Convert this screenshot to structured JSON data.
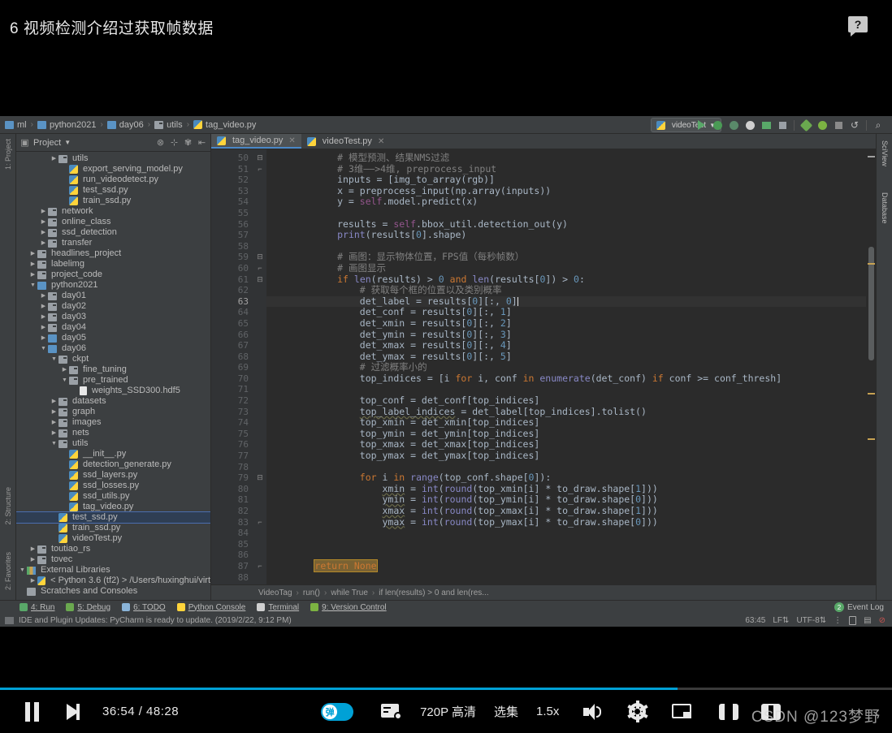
{
  "page": {
    "title": "6 视频检测介绍过获取帧数据",
    "help_icon": "help-bubble-icon",
    "help_glyph": "?"
  },
  "ide": {
    "breadcrumb": [
      {
        "label": "ml",
        "icon": "folder-icon"
      },
      {
        "label": "python2021",
        "icon": "folder-icon"
      },
      {
        "label": "day06",
        "icon": "folder-icon"
      },
      {
        "label": "utils",
        "icon": "folder-icon"
      },
      {
        "label": "tag_video.py",
        "icon": "python-file-icon"
      }
    ],
    "run_config": "videoTest",
    "toolbar_icons": [
      "run-icon",
      "debug-icon",
      "coverage-icon",
      "profile-icon",
      "attach-icon",
      "stop-icon",
      "update-icon",
      "vcs-icon",
      "window-icon",
      "undo-icon",
      "search-icon"
    ],
    "project_panel": {
      "title": "Project",
      "header_icons": [
        "collapse-icon",
        "expand-icon",
        "settings-icon",
        "hide-icon"
      ],
      "tree": [
        {
          "depth": 3,
          "arrow": "right",
          "icon": "folder",
          "label": "utils"
        },
        {
          "depth": 4,
          "arrow": "",
          "icon": "py",
          "label": "export_serving_model.py"
        },
        {
          "depth": 4,
          "arrow": "",
          "icon": "py",
          "label": "run_videodetect.py"
        },
        {
          "depth": 4,
          "arrow": "",
          "icon": "py",
          "label": "test_ssd.py"
        },
        {
          "depth": 4,
          "arrow": "",
          "icon": "py",
          "label": "train_ssd.py"
        },
        {
          "depth": 2,
          "arrow": "right",
          "icon": "folder",
          "label": "network"
        },
        {
          "depth": 2,
          "arrow": "right",
          "icon": "folder",
          "label": "online_class"
        },
        {
          "depth": 2,
          "arrow": "right",
          "icon": "folder",
          "label": "ssd_detection"
        },
        {
          "depth": 2,
          "arrow": "right",
          "icon": "folder",
          "label": "transfer"
        },
        {
          "depth": 1,
          "arrow": "right",
          "icon": "folder",
          "label": "headlines_project"
        },
        {
          "depth": 1,
          "arrow": "right",
          "icon": "folder",
          "label": "labelimg"
        },
        {
          "depth": 1,
          "arrow": "right",
          "icon": "folder",
          "label": "project_code"
        },
        {
          "depth": 1,
          "arrow": "down",
          "icon": "folder-open",
          "label": "python2021"
        },
        {
          "depth": 2,
          "arrow": "right",
          "icon": "folder",
          "label": "day01"
        },
        {
          "depth": 2,
          "arrow": "right",
          "icon": "folder",
          "label": "day02"
        },
        {
          "depth": 2,
          "arrow": "right",
          "icon": "folder",
          "label": "day03"
        },
        {
          "depth": 2,
          "arrow": "right",
          "icon": "folder",
          "label": "day04"
        },
        {
          "depth": 2,
          "arrow": "right",
          "icon": "folder-open",
          "label": "day05"
        },
        {
          "depth": 2,
          "arrow": "down",
          "icon": "folder-open",
          "label": "day06"
        },
        {
          "depth": 3,
          "arrow": "down",
          "icon": "folder",
          "label": "ckpt"
        },
        {
          "depth": 4,
          "arrow": "right",
          "icon": "folder",
          "label": "fine_tuning"
        },
        {
          "depth": 4,
          "arrow": "down",
          "icon": "folder",
          "label": "pre_trained"
        },
        {
          "depth": 5,
          "arrow": "",
          "icon": "doc",
          "label": "weights_SSD300.hdf5"
        },
        {
          "depth": 3,
          "arrow": "right",
          "icon": "folder",
          "label": "datasets"
        },
        {
          "depth": 3,
          "arrow": "right",
          "icon": "folder",
          "label": "graph"
        },
        {
          "depth": 3,
          "arrow": "right",
          "icon": "folder",
          "label": "images"
        },
        {
          "depth": 3,
          "arrow": "right",
          "icon": "folder",
          "label": "nets"
        },
        {
          "depth": 3,
          "arrow": "down",
          "icon": "folder",
          "label": "utils"
        },
        {
          "depth": 4,
          "arrow": "",
          "icon": "py",
          "label": "__init__.py"
        },
        {
          "depth": 4,
          "arrow": "",
          "icon": "py",
          "label": "detection_generate.py"
        },
        {
          "depth": 4,
          "arrow": "",
          "icon": "py",
          "label": "ssd_layers.py"
        },
        {
          "depth": 4,
          "arrow": "",
          "icon": "py",
          "label": "ssd_losses.py"
        },
        {
          "depth": 4,
          "arrow": "",
          "icon": "py",
          "label": "ssd_utils.py"
        },
        {
          "depth": 4,
          "arrow": "",
          "icon": "py",
          "label": "tag_video.py"
        },
        {
          "depth": 3,
          "arrow": "",
          "icon": "py",
          "label": "test_ssd.py",
          "selected": true
        },
        {
          "depth": 3,
          "arrow": "",
          "icon": "py",
          "label": "train_ssd.py"
        },
        {
          "depth": 3,
          "arrow": "",
          "icon": "py",
          "label": "videoTest.py"
        },
        {
          "depth": 1,
          "arrow": "right",
          "icon": "folder",
          "label": "toutiao_rs"
        },
        {
          "depth": 1,
          "arrow": "right",
          "icon": "folder",
          "label": "tovec"
        },
        {
          "depth": 0,
          "arrow": "down",
          "icon": "ext",
          "label": "External Libraries"
        },
        {
          "depth": 1,
          "arrow": "right",
          "icon": "py",
          "label": "< Python 3.6 (tf2) >  /Users/huxinghui/virt"
        },
        {
          "depth": 0,
          "arrow": "",
          "icon": "scratch",
          "label": "Scratches and Consoles"
        }
      ]
    },
    "editor_tabs": [
      {
        "label": "tag_video.py",
        "active": true
      },
      {
        "label": "videoTest.py",
        "active": false
      }
    ],
    "editor": {
      "first_line": 50,
      "last_line": 88,
      "current_line": 63,
      "lines": [
        {
          "n": 50,
          "text": "            # 模型预测、结果NMS过滤",
          "fold": "minus"
        },
        {
          "n": 51,
          "text": "            # 3维——>4维, preprocess_input",
          "fold": "end"
        },
        {
          "n": 52,
          "text": "            inputs = [img_to_array(rgb)]"
        },
        {
          "n": 53,
          "text": "            x = preprocess_input(np.array(inputs))"
        },
        {
          "n": 54,
          "text": "            y = self.model.predict(x)"
        },
        {
          "n": 55,
          "text": ""
        },
        {
          "n": 56,
          "text": "            results = self.bbox_util.detection_out(y)"
        },
        {
          "n": 57,
          "text": "            print(results[0].shape)"
        },
        {
          "n": 58,
          "text": ""
        },
        {
          "n": 59,
          "text": "            # 画图：显示物体位置，FPS值（每秒帧数）",
          "fold": "minus"
        },
        {
          "n": 60,
          "text": "            # 画图显示",
          "fold": "end"
        },
        {
          "n": 61,
          "text": "            if len(results) > 0 and len(results[0]) > 0:",
          "fold": "minus"
        },
        {
          "n": 62,
          "text": "                # 获取每个框的位置以及类别概率"
        },
        {
          "n": 63,
          "text": "                det_label = results[0][:, 0]"
        },
        {
          "n": 64,
          "text": "                det_conf = results[0][:, 1]"
        },
        {
          "n": 65,
          "text": "                det_xmin = results[0][:, 2]"
        },
        {
          "n": 66,
          "text": "                det_ymin = results[0][:, 3]"
        },
        {
          "n": 67,
          "text": "                det_xmax = results[0][:, 4]"
        },
        {
          "n": 68,
          "text": "                det_ymax = results[0][:, 5]"
        },
        {
          "n": 69,
          "text": "                # 过滤概率小的"
        },
        {
          "n": 70,
          "text": "                top_indices = [i for i, conf in enumerate(det_conf) if conf >= conf_thresh]"
        },
        {
          "n": 71,
          "text": ""
        },
        {
          "n": 72,
          "text": "                top_conf = det_conf[top_indices]"
        },
        {
          "n": 73,
          "text": "                top_label_indices = det_label[top_indices].tolist()"
        },
        {
          "n": 74,
          "text": "                top_xmin = det_xmin[top_indices]"
        },
        {
          "n": 75,
          "text": "                top_ymin = det_ymin[top_indices]"
        },
        {
          "n": 76,
          "text": "                top_xmax = det_xmax[top_indices]"
        },
        {
          "n": 77,
          "text": "                top_ymax = det_ymax[top_indices]"
        },
        {
          "n": 78,
          "text": ""
        },
        {
          "n": 79,
          "text": "                for i in range(top_conf.shape[0]):",
          "fold": "minus"
        },
        {
          "n": 80,
          "text": "                    xmin = int(round(top_xmin[i] * to_draw.shape[1]))"
        },
        {
          "n": 81,
          "text": "                    ymin = int(round(top_ymin[i] * to_draw.shape[0]))"
        },
        {
          "n": 82,
          "text": "                    xmax = int(round(top_xmax[i] * to_draw.shape[1]))"
        },
        {
          "n": 83,
          "text": "                    ymax = int(round(top_ymax[i] * to_draw.shape[0]))",
          "fold": "end"
        },
        {
          "n": 84,
          "text": ""
        },
        {
          "n": 85,
          "text": ""
        },
        {
          "n": 86,
          "text": ""
        },
        {
          "n": 87,
          "text": "        return None",
          "fold": "end"
        },
        {
          "n": 88,
          "text": ""
        }
      ]
    },
    "editor_breadcrumb": [
      "VideoTag",
      "run()",
      "while True",
      "if len(results) > 0 and len(res..."
    ],
    "right_tool_tabs": [
      "SciView",
      "Database"
    ],
    "left_tool_tabs": [
      "1: Project",
      "2: Structure",
      "2: Favorites"
    ],
    "bottom_tool_tabs": [
      {
        "key": "4",
        "label": "4: Run",
        "icon": "run-icon"
      },
      {
        "key": "5",
        "label": "5: Debug",
        "icon": "debug-icon"
      },
      {
        "key": "6",
        "label": "6: TODO",
        "icon": "todo-icon"
      },
      {
        "key": "",
        "label": "Python Console",
        "icon": "python-icon"
      },
      {
        "key": "",
        "label": "Terminal",
        "icon": "terminal-icon"
      },
      {
        "key": "9",
        "label": "9: Version Control",
        "icon": "vcs-icon"
      }
    ],
    "event_log": {
      "label": "Event Log",
      "count": "2"
    },
    "status": {
      "message": "IDE and Plugin Updates: PyCharm is ready to update. (2019/2/22, 9:12 PM)",
      "caret_position": "63:45",
      "line_separator": "LF",
      "encoding": "UTF-8",
      "icons": [
        "indent-icon",
        "lock-icon",
        "memory-icon",
        "inspection-icon"
      ]
    }
  },
  "player": {
    "progress_percent": 76,
    "controls": {
      "pause": "pause-icon",
      "next": "next-episode-icon",
      "time": "36:54 / 48:28",
      "danmaku_toggle": "弹",
      "danmaku_settings": "danmaku-settings-icon",
      "quality": "720P 高清",
      "episodes": "选集",
      "speed": "1.5x",
      "volume": "volume-icon",
      "settings": "settings-gear-icon",
      "pip": "picture-in-picture-icon",
      "widescreen": "widescreen-icon",
      "fullscreen": "fullscreen-icon"
    },
    "watermark": "CSDN @123梦野"
  }
}
